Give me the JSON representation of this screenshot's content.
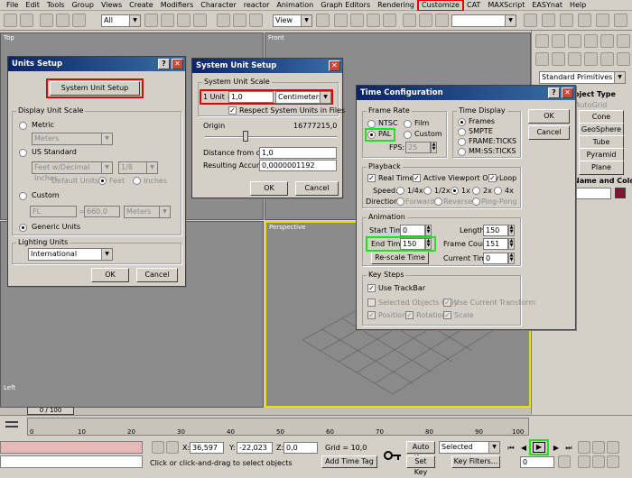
{
  "menu": [
    "File",
    "Edit",
    "Tools",
    "Group",
    "Views",
    "Create",
    "Modifiers",
    "Character",
    "reactor",
    "Animation",
    "Graph Editors",
    "Rendering",
    "Customize",
    "CAT",
    "MAXScript",
    "EASYnat",
    "Help"
  ],
  "toolbar": {
    "selection_filter": "All",
    "ref_coord": "View"
  },
  "viewports": {
    "top": "Top",
    "front": "Front",
    "left": "Left",
    "perspective": "Perspective"
  },
  "command_panel": {
    "category": "Standard Primitives",
    "rollout_object_type": "Object Type",
    "autogrid": "AutoGrid",
    "buttons": [
      "Cone",
      "GeoSphere",
      "Tube",
      "Pyramid",
      "Plane"
    ],
    "rollout_name_color": "Name and Color"
  },
  "units_setup": {
    "title": "Units Setup",
    "system_unit_setup_btn": "System Unit Setup",
    "display_unit_scale": "Display Unit Scale",
    "metric": "Metric",
    "metric_value": "Meters",
    "us_standard": "US Standard",
    "us_value": "Feet w/Decimal Inches",
    "us_frac": "1/8",
    "default_units": "Default Units:",
    "feet": "Feet",
    "inches": "Inches",
    "custom": "Custom",
    "custom_name": "FL",
    "custom_eq": "=",
    "custom_value": "660,0",
    "custom_unit": "Meters",
    "generic_units": "Generic Units",
    "lighting_units": "Lighting Units",
    "lighting_value": "International",
    "ok": "OK",
    "cancel": "Cancel"
  },
  "system_unit_setup": {
    "title": "System Unit Setup",
    "group": "System Unit Scale",
    "one_unit": "1 Unit =",
    "value": "1,0",
    "unit": "Centimeters",
    "respect": "Respect System Units in Files",
    "origin": "Origin",
    "origin_value": "16777215,0",
    "distance_label": "Distance from origin:",
    "distance_value": "1,0",
    "accuracy_label": "Resulting Accuracy:",
    "accuracy_value": "0,0000001192",
    "ok": "OK",
    "cancel": "Cancel"
  },
  "time_config": {
    "title": "Time Configuration",
    "frame_rate": "Frame Rate",
    "ntsc": "NTSC",
    "film": "Film",
    "pal": "PAL",
    "custom": "Custom",
    "fps_label": "FPS:",
    "fps_value": "25",
    "time_display": "Time Display",
    "frames": "Frames",
    "smpte": "SMPTE",
    "frame_ticks": "FRAME:TICKS",
    "mm_ss_ticks": "MM:SS:TICKS",
    "ok": "OK",
    "cancel": "Cancel",
    "playback": "Playback",
    "real_time": "Real Time",
    "active_vp": "Active Viewport Only",
    "loop": "Loop",
    "speed": "Speed:",
    "speeds": [
      "1/4x",
      "1/2x",
      "1x",
      "2x",
      "4x"
    ],
    "direction": "Direction:",
    "directions": [
      "Forward",
      "Reverse",
      "Ping-Pong"
    ],
    "animation": "Animation",
    "start_time_label": "Start Time:",
    "start_time": "0",
    "length_label": "Length:",
    "length": "150",
    "end_time_label": "End Time:",
    "end_time": "150",
    "frame_count_label": "Frame Count:",
    "frame_count": "151",
    "rescale": "Re-scale Time",
    "current_time_label": "Current Time:",
    "current_time": "0",
    "key_steps": "Key Steps",
    "use_trackbar": "Use TrackBar",
    "selected_only": "Selected Objects Only",
    "use_current": "Use Current Transform",
    "position": "Position",
    "rotation": "Rotation",
    "scale": "Scale"
  },
  "status": {
    "frame_counter": "0 / 100",
    "x_label": "X:",
    "x_value": "36,597",
    "y_label": "Y:",
    "y_value": "-22,023",
    "z_label": "Z:",
    "z_value": "0,0",
    "grid": "Grid = 10,0",
    "prompt": "Click or click-and-drag to select objects",
    "add_time_tag": "Add Time Tag",
    "auto_key": "Auto Key",
    "set_key": "Set Key",
    "selected": "Selected",
    "key_filters": "Key Filters...",
    "current_frame": "0"
  },
  "timeline_ticks": [
    "0",
    "10",
    "20",
    "30",
    "40",
    "50",
    "60",
    "70",
    "80",
    "90",
    "100"
  ]
}
